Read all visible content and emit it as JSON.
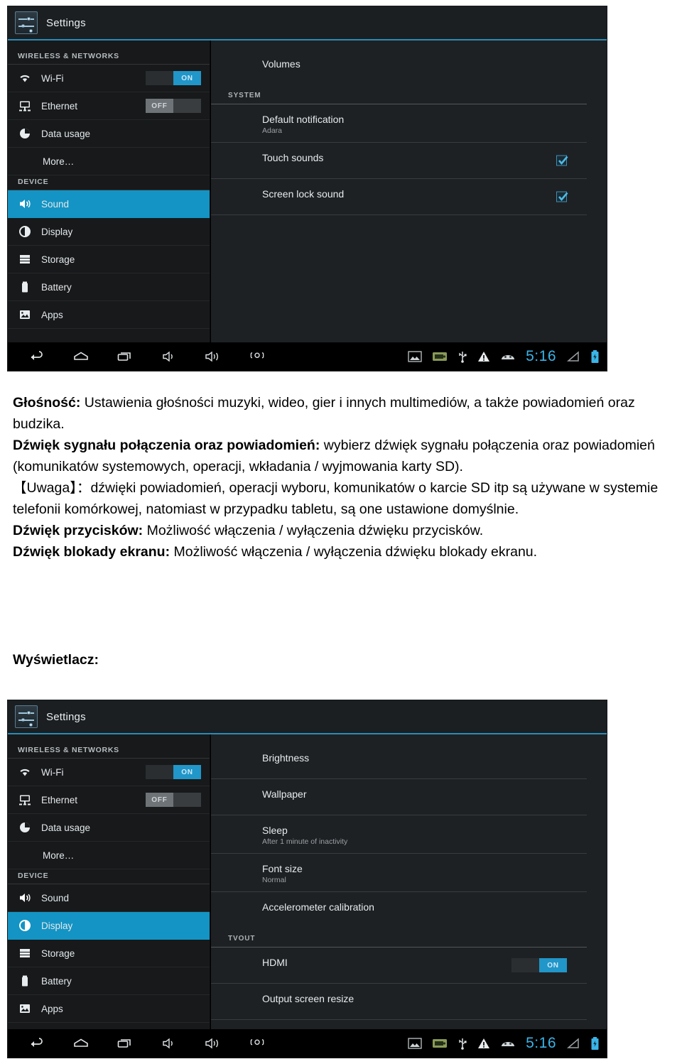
{
  "screenshots": [
    {
      "id": "sound-settings",
      "titlebar": {
        "app_icon": "settings-sliders-icon",
        "title": "Settings"
      },
      "sidebar": {
        "groups": [
          {
            "header": "WIRELESS & NETWORKS",
            "items": [
              {
                "label": "Wi-Fi",
                "icon": "wifi-icon",
                "toggle": "ON",
                "toggle_state": "on",
                "selected": false
              },
              {
                "label": "Ethernet",
                "icon": "ethernet-icon",
                "toggle": "OFF",
                "toggle_state": "off",
                "selected": false
              },
              {
                "label": "Data usage",
                "icon": "data-usage-pie-icon",
                "selected": false
              },
              {
                "label": "More…",
                "icon": null,
                "selected": false
              }
            ]
          },
          {
            "header": "DEVICE",
            "items": [
              {
                "label": "Sound",
                "icon": "speaker-icon",
                "selected": true
              },
              {
                "label": "Display",
                "icon": "brightness-icon",
                "selected": false
              },
              {
                "label": "Storage",
                "icon": "storage-icon",
                "selected": false
              },
              {
                "label": "Battery",
                "icon": "battery-icon",
                "selected": false
              },
              {
                "label": "Apps",
                "icon": "apps-image-icon",
                "selected": false
              }
            ]
          }
        ]
      },
      "content": {
        "rows": [
          {
            "kind": "row",
            "title": "Volumes",
            "sub": null,
            "control": null
          },
          {
            "kind": "group",
            "title": "SYSTEM"
          },
          {
            "kind": "row",
            "title": "Default notification",
            "sub": "Adara",
            "control": null
          },
          {
            "kind": "row",
            "title": "Touch sounds",
            "sub": null,
            "control": "checkbox",
            "checked": true
          },
          {
            "kind": "row",
            "title": "Screen lock sound",
            "sub": null,
            "control": "checkbox",
            "checked": true
          }
        ]
      },
      "sysbar": {
        "nav": [
          "back-icon",
          "home-icon",
          "recents-icon",
          "volume-down-icon",
          "volume-up-icon",
          "screenshot-icon"
        ],
        "status": [
          "screenshot-thumb-icon",
          "sd-card-icon",
          "usb-icon",
          "warning-icon",
          "android-head-icon"
        ],
        "clock": "5:16",
        "right_icons": [
          "signal-icon",
          "battery-charging-icon"
        ]
      }
    },
    {
      "id": "display-settings",
      "titlebar": {
        "app_icon": "settings-sliders-icon",
        "title": "Settings"
      },
      "sidebar": {
        "groups": [
          {
            "header": "WIRELESS & NETWORKS",
            "items": [
              {
                "label": "Wi-Fi",
                "icon": "wifi-icon",
                "toggle": "ON",
                "toggle_state": "on",
                "selected": false
              },
              {
                "label": "Ethernet",
                "icon": "ethernet-icon",
                "toggle": "OFF",
                "toggle_state": "off",
                "selected": false
              },
              {
                "label": "Data usage",
                "icon": "data-usage-pie-icon",
                "selected": false
              },
              {
                "label": "More…",
                "icon": null,
                "selected": false
              }
            ]
          },
          {
            "header": "DEVICE",
            "items": [
              {
                "label": "Sound",
                "icon": "speaker-icon",
                "selected": false
              },
              {
                "label": "Display",
                "icon": "brightness-icon",
                "selected": true
              },
              {
                "label": "Storage",
                "icon": "storage-icon",
                "selected": false
              },
              {
                "label": "Battery",
                "icon": "battery-icon",
                "selected": false
              },
              {
                "label": "Apps",
                "icon": "apps-image-icon",
                "selected": false
              }
            ]
          }
        ]
      },
      "content": {
        "rows": [
          {
            "kind": "row",
            "title": "Brightness",
            "sub": null,
            "control": null
          },
          {
            "kind": "row",
            "title": "Wallpaper",
            "sub": null,
            "control": null
          },
          {
            "kind": "row",
            "title": "Sleep",
            "sub": "After 1 minute of inactivity",
            "control": null
          },
          {
            "kind": "row",
            "title": "Font size",
            "sub": "Normal",
            "control": null
          },
          {
            "kind": "row",
            "title": "Accelerometer calibration",
            "sub": null,
            "control": null
          },
          {
            "kind": "group",
            "title": "TVOUT"
          },
          {
            "kind": "row",
            "title": "HDMI",
            "sub": null,
            "control": "toggle",
            "toggle": "ON"
          },
          {
            "kind": "row",
            "title": "Output screen resize",
            "sub": null,
            "control": null
          }
        ]
      },
      "sysbar": {
        "nav": [
          "back-icon",
          "home-icon",
          "recents-icon",
          "volume-down-icon",
          "volume-up-icon",
          "screenshot-icon"
        ],
        "status": [
          "screenshot-thumb-icon",
          "sd-card-icon",
          "usb-icon",
          "warning-icon",
          "android-head-icon"
        ],
        "clock": "5:16",
        "right_icons": [
          "signal-icon",
          "battery-charging-icon"
        ]
      }
    }
  ],
  "prose": {
    "p1_bold": "Głośność:",
    "p1_rest": " Ustawienia głośności muzyki, wideo, gier i innych multimediów, a także powiadomień oraz budzika.",
    "p2_bold": "Dźwięk sygnału połączenia oraz powiadomień:",
    "p2_rest": " wybierz dźwięk sygnału połączenia oraz powiadomień (komunikatów systemowych, operacji, wkładania / wyjmowania karty SD).",
    "p3_bold": "【Uwaga】",
    "p3_rest": "：dźwięki powiadomień, operacji wyboru, komunikatów o karcie SD itp są używane w systemie telefonii komórkowej, natomiast w przypadku tabletu, są one ustawione domyślnie.",
    "p4_bold": "Dźwięk przycisków:",
    "p4_rest": " Możliwość włączenia / wyłączenia dźwięku przycisków.",
    "p5_bold": "Dźwięk blokady ekranu:",
    "p5_rest": " Możliwość włączenia / wyłączenia dźwięku blokady ekranu.",
    "heading_display": "Wyświetlacz:"
  },
  "colors": {
    "accent": "#1394c4",
    "toggle_on": "#2196c9",
    "clock": "#3bb4e8",
    "panel_bg": "#1e2124",
    "sidebar_bg": "#17191b"
  }
}
